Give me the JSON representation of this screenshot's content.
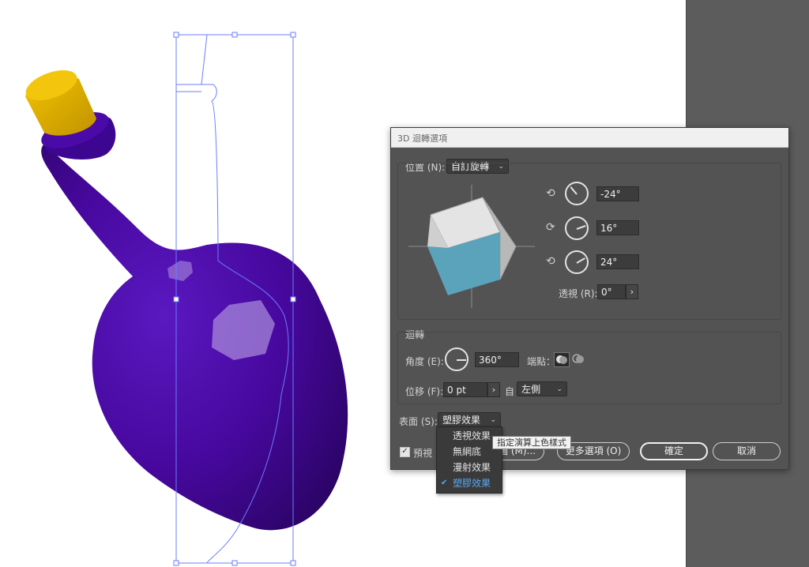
{
  "dialog": {
    "title": "3D 迴轉選項",
    "position": {
      "label": "位置 (N):",
      "preset": "自訂旋轉",
      "x_rotation": "-24°",
      "y_rotation": "16°",
      "z_rotation": "24°",
      "perspective_label": "透視 (R):",
      "perspective_value": "0°",
      "stepper_label": "›"
    },
    "revolve": {
      "section_label": "迴轉",
      "angle_label": "角度 (E):",
      "angle_value": "360°",
      "cap_label": "端點：",
      "offset_label": "位移 (F):",
      "offset_value": "0 pt",
      "stepper_label": "›",
      "from_label": "自",
      "from_value": "左側"
    },
    "surface": {
      "label": "表面 (S):",
      "value": "塑膠效果"
    },
    "preview_label": "預視 (P)",
    "map_art_button": "圖 (M)...",
    "more_options_button": "更多選項 (O)",
    "ok_button": "確定",
    "cancel_button": "取消"
  },
  "surface_menu": {
    "items": [
      "透視效果",
      "無網底",
      "漫射效果",
      "塑膠效果"
    ],
    "selected": "塑膠效果",
    "check": "✔"
  },
  "tooltip": "指定演算上色樣式",
  "icons": {
    "x_axis": "rotate-x-icon",
    "y_axis": "rotate-y-icon",
    "z_axis": "rotate-z-icon",
    "chevron": "chevron-down-icon"
  },
  "colors": {
    "bottle": "#4a0aa0",
    "cork": "#e2b300",
    "cube_front": "#5aa3bb",
    "cube_top": "#e4e4e4",
    "cube_side": "#b8b8b8",
    "selection": "#6b7cff",
    "dialog_bg": "#535353",
    "menu_selected": "#58a9f2"
  }
}
